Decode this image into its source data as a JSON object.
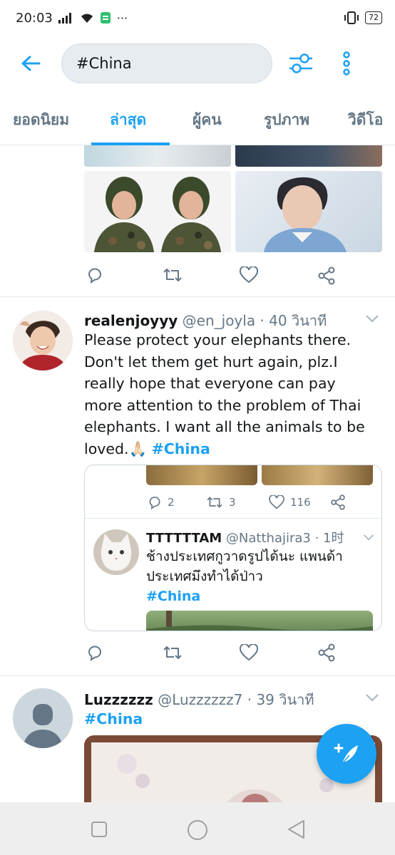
{
  "status": {
    "time": "20:03",
    "dots": "···",
    "battery": "72"
  },
  "search": {
    "query": "#China"
  },
  "tabs": [
    {
      "label": "ยอดนิยม"
    },
    {
      "label": "ล่าสุด"
    },
    {
      "label": "ผู้คน"
    },
    {
      "label": "รูปภาพ"
    },
    {
      "label": "วิดีโอ"
    }
  ],
  "tweets": [
    {
      "name": "realenjoyyy",
      "meta": "@en_joyla · 40 วินาที",
      "text": "Please protect your elephants there. Don't let them get hurt again, plz.I really hope that everyone can pay more attention to the problem of Thai elephants. I want all the animals to be loved.🙏🏻 ",
      "hashtag": "#China",
      "quote": {
        "replies": "2",
        "retweets": "3",
        "likes": "116",
        "name": "TTTTTTAM",
        "meta": "@Natthajira3 · 1时",
        "text": "ช้างประเทศกูวาดรูปได้นะ แพนด้าประเทศมึงทำได้ป่าว",
        "hashtag": "#China"
      }
    },
    {
      "name": "Luzzzzzz",
      "meta": "@Luzzzzzz7 · 39 วินาที",
      "hashtag": "#China"
    }
  ]
}
